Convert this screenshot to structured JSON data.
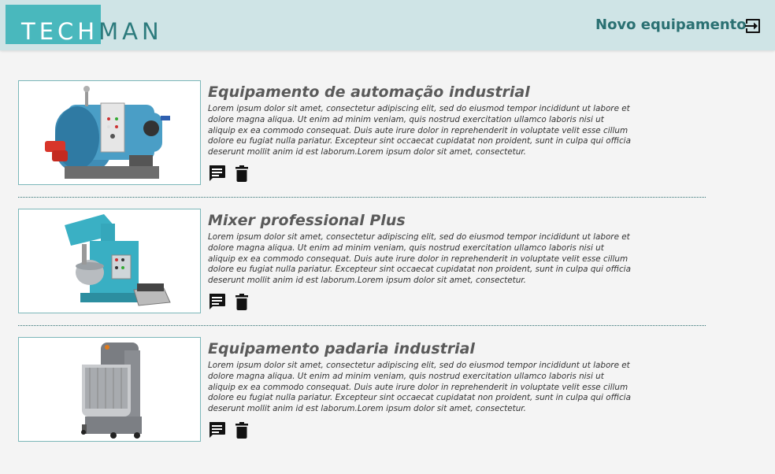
{
  "header": {
    "logo_part1": "TECH",
    "logo_part2": "MAN",
    "new_equipment_label": "Novo equipamento",
    "logout_icon": "logout-icon"
  },
  "colors": {
    "header_bg": "#cfe4e6",
    "logo_box": "#49b8bd",
    "accent_dark": "#2a7072",
    "thumb_border": "#7bb7b9"
  },
  "equipment": [
    {
      "title": "Equipamento de automação industrial",
      "description": "Lorem ipsum dolor sit amet, consectetur adipiscing elit, sed do eiusmod tempor incididunt ut labore et dolore magna aliqua. Ut enim ad minim veniam, quis nostrud exercitation ullamco laboris nisi ut aliquip ex ea commodo consequat. Duis aute irure dolor in reprehenderit in voluptate velit esse cillum dolore eu fugiat nulla pariatur. Excepteur sint occaecat cupidatat non proident, sunt in culpa qui officia deserunt mollit anim id est laborum.Lorem ipsum dolor sit amet, consectetur.",
      "image": "industrial-boiler-image"
    },
    {
      "title": "Mixer professional Plus",
      "description": "Lorem ipsum dolor sit amet, consectetur adipiscing elit, sed do eiusmod tempor incididunt ut labore et dolore magna aliqua. Ut enim ad minim veniam, quis nostrud exercitation ullamco laboris nisi ut aliquip ex ea commodo consequat. Duis aute irure dolor in reprehenderit in voluptate velit esse cillum dolore eu fugiat nulla pariatur. Excepteur sint occaecat cupidatat non proident, sunt in culpa qui officia deserunt mollit anim id est laborum.Lorem ipsum dolor sit amet, consectetur.",
      "image": "planetary-mixer-image"
    },
    {
      "title": "Equipamento padaria industrial",
      "description": "Lorem ipsum dolor sit amet, consectetur adipiscing elit, sed do eiusmod tempor incididunt ut labore et dolore magna aliqua. Ut enim ad minim veniam, quis nostrud exercitation ullamco laboris nisi ut aliquip ex ea commodo consequat. Duis aute irure dolor in reprehenderit in voluptate velit esse cillum dolore eu fugiat nulla pariatur. Excepteur sint occaecat cupidatat non proident, sunt in culpa qui officia deserunt mollit anim id est laborum.Lorem ipsum dolor sit amet, consectetur.",
      "image": "spiral-dough-mixer-image"
    }
  ]
}
